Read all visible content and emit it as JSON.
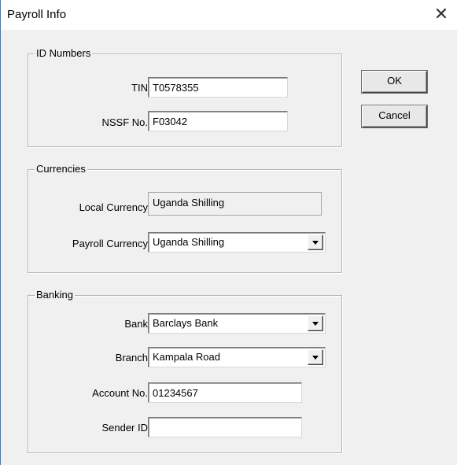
{
  "window": {
    "title": "Payroll Info",
    "close_glyph": "✕"
  },
  "id_numbers": {
    "legend": "ID Numbers",
    "tin_label": "TIN",
    "tin_value": "T0578355",
    "nssf_label": "NSSF No.",
    "nssf_value": "F03042"
  },
  "currencies": {
    "legend": "Currencies",
    "local_label": "Local Currency",
    "local_value": "Uganda Shilling",
    "payroll_label": "Payroll Currency",
    "payroll_value": "Uganda Shilling"
  },
  "banking": {
    "legend": "Banking",
    "bank_label": "Bank",
    "bank_value": "Barclays Bank",
    "branch_label": "Branch",
    "branch_value": "Kampala Road",
    "account_label": "Account No.",
    "account_value": "01234567",
    "sender_label": "Sender ID",
    "sender_value": ""
  },
  "buttons": {
    "ok_label": "OK",
    "cancel_label": "Cancel"
  }
}
